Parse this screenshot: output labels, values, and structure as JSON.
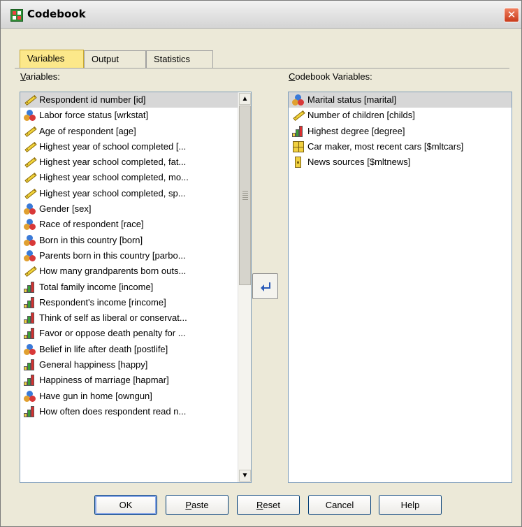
{
  "window": {
    "title": "Codebook",
    "close_glyph": "✕"
  },
  "tabs": [
    {
      "label": "Variables",
      "active": true
    },
    {
      "label": "Output",
      "active": false
    },
    {
      "label": "Statistics",
      "active": false
    }
  ],
  "source_list": {
    "label_accel": "V",
    "label_rest": "ariables:",
    "items": [
      {
        "icon": "scale-icon",
        "label": "Respondent id number [id]",
        "selected": true
      },
      {
        "icon": "nominal-icon",
        "label": "Labor force status [wrkstat]"
      },
      {
        "icon": "scale-icon",
        "label": "Age of respondent [age]"
      },
      {
        "icon": "scale-icon",
        "label": "Highest year of school completed [..."
      },
      {
        "icon": "scale-icon",
        "label": "Highest year school completed, fat..."
      },
      {
        "icon": "scale-icon",
        "label": "Highest year school completed, mo..."
      },
      {
        "icon": "scale-icon",
        "label": "Highest year school completed, sp..."
      },
      {
        "icon": "nominal-icon",
        "label": "Gender [sex]"
      },
      {
        "icon": "nominal-icon",
        "label": "Race of respondent [race]"
      },
      {
        "icon": "nominal-icon",
        "label": "Born in this country [born]"
      },
      {
        "icon": "nominal-icon",
        "label": "Parents born in this country [parbo..."
      },
      {
        "icon": "scale-icon",
        "label": "How many grandparents born outs..."
      },
      {
        "icon": "ordinal-icon",
        "label": "Total family income [income]"
      },
      {
        "icon": "ordinal-icon",
        "label": "Respondent's income [rincome]"
      },
      {
        "icon": "ordinal-icon",
        "label": "Think of self as liberal or conservat..."
      },
      {
        "icon": "ordinal-icon",
        "label": "Favor or oppose death penalty for ..."
      },
      {
        "icon": "nominal-icon",
        "label": "Belief in life after death [postlife]"
      },
      {
        "icon": "ordinal-icon",
        "label": "General happiness [happy]"
      },
      {
        "icon": "ordinal-icon",
        "label": "Happiness of marriage [hapmar]"
      },
      {
        "icon": "nominal-icon",
        "label": "Have gun in home [owngun]"
      },
      {
        "icon": "ordinal-icon",
        "label": "How often does respondent read n..."
      }
    ]
  },
  "target_list": {
    "label_accel": "C",
    "label_rest": "odebook Variables:",
    "items": [
      {
        "icon": "nominal-icon",
        "label": "Marital status [marital]",
        "selected": true
      },
      {
        "icon": "scale-icon",
        "label": "Number of children [childs]"
      },
      {
        "icon": "ordinal-icon",
        "label": "Highest degree [degree]"
      },
      {
        "icon": "multiple-response-set-icon",
        "label": "Car maker, most recent cars [$mltcars]"
      },
      {
        "icon": "multiple-dichotomy-set-icon",
        "label": "News sources [$mltnews]"
      }
    ]
  },
  "scrollbar": {
    "up_glyph": "▲",
    "down_glyph": "▼"
  },
  "buttons": {
    "ok": {
      "label": "OK"
    },
    "paste": {
      "accel": "P",
      "rest": "aste"
    },
    "reset": {
      "accel": "R",
      "rest": "eset"
    },
    "cancel": {
      "label": "Cancel"
    },
    "help": {
      "label": "Help"
    }
  }
}
